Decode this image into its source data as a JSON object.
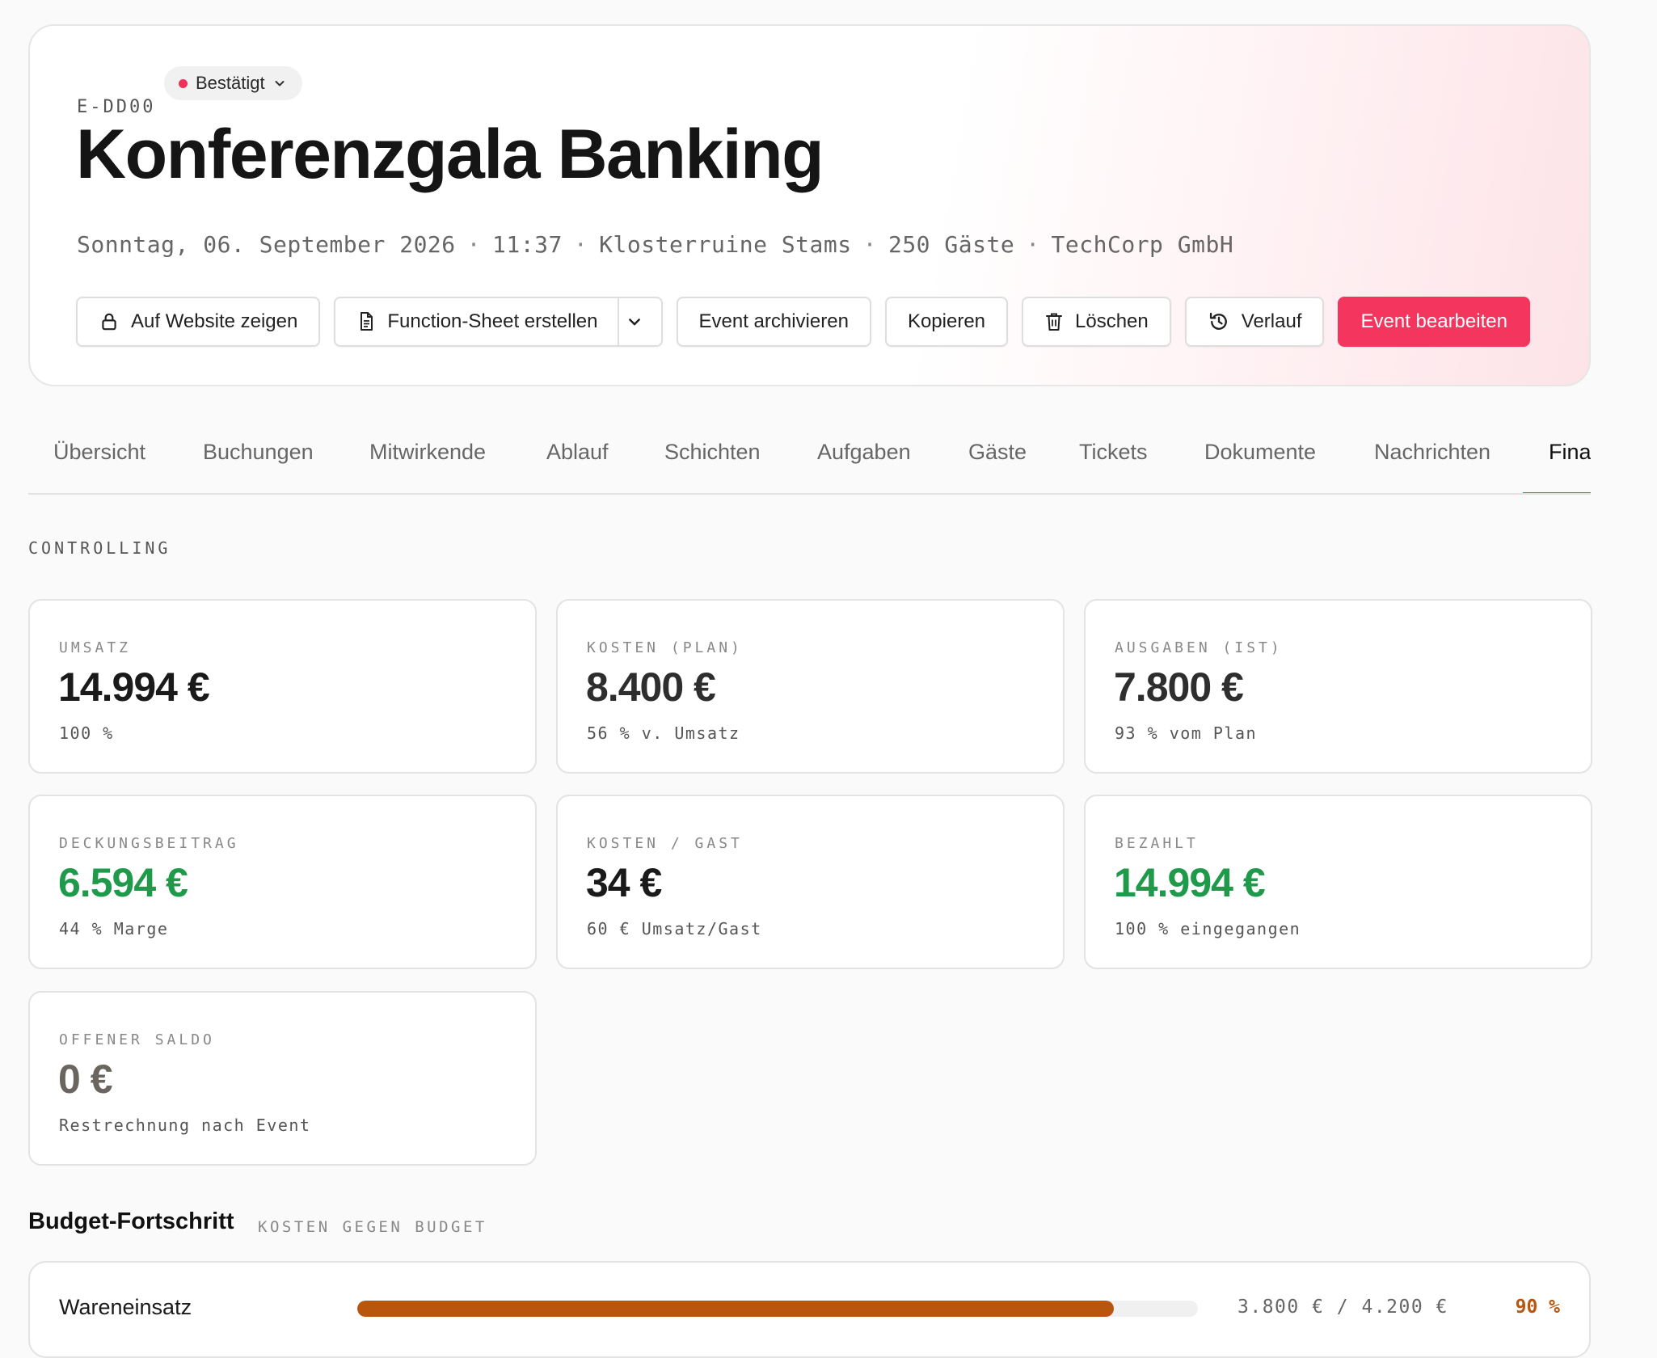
{
  "event": {
    "id": "E-DD00",
    "status": "Bestätigt",
    "title": "Konferenzgala Banking",
    "date": "Sonntag, 06. September 2026",
    "time": "11:37",
    "location": "Klosterruine Stams",
    "guests": "250 Gäste",
    "client": "TechCorp GmbH",
    "meta_separator": "·"
  },
  "actions": {
    "show_on_website": "Auf Website zeigen",
    "function_sheet": "Function-Sheet erstellen",
    "archive": "Event archivieren",
    "copy": "Kopieren",
    "delete": "Löschen",
    "history": "Verlauf",
    "edit": "Event bearbeiten"
  },
  "tabs": [
    {
      "label": "Übersicht",
      "active": false
    },
    {
      "label": "Buchungen",
      "active": false
    },
    {
      "label": "Mitwirkende",
      "active": false
    },
    {
      "label": "Ablauf",
      "active": false
    },
    {
      "label": "Schichten",
      "active": false
    },
    {
      "label": "Aufgaben",
      "active": false
    },
    {
      "label": "Gäste",
      "active": false
    },
    {
      "label": "Tickets",
      "active": false
    },
    {
      "label": "Dokumente",
      "active": false
    },
    {
      "label": "Nachrichten",
      "active": false
    },
    {
      "label": "Finanzen",
      "active": true
    }
  ],
  "controlling": {
    "section_label": "CONTROLLING",
    "kpis": [
      {
        "label": "UMSATZ",
        "value": "14.994 €",
        "sub": "100 %",
        "color": "#1a1a1a"
      },
      {
        "label": "KOSTEN (PLAN)",
        "value": "8.400 €",
        "sub": "56 % v. Umsatz",
        "color": "#2e2e2e"
      },
      {
        "label": "AUSGABEN (IST)",
        "value": "7.800 €",
        "sub": "93 % vom Plan",
        "color": "#2e2e2e"
      },
      {
        "label": "DECKUNGSBEITRAG",
        "value": "6.594 €",
        "sub": "44 % Marge",
        "color": "#1f9a4a"
      },
      {
        "label": "KOSTEN / GAST",
        "value": "34 €",
        "sub": "60 € Umsatz/Gast",
        "color": "#1a1a1a"
      },
      {
        "label": "BEZAHLT",
        "value": "14.994 €",
        "sub": "100 % eingegangen",
        "color": "#1f9a4a"
      },
      {
        "label": "OFFENER SALDO",
        "value": "0 €",
        "sub": "Restrechnung nach Event",
        "color": "#6b6560"
      }
    ]
  },
  "budget": {
    "title": "Budget-Fortschritt",
    "subtitle": "KOSTEN GEGEN BUDGET",
    "rows": [
      {
        "label": "Wareneinsatz",
        "amount": "3.800 € / 4.200 €",
        "percent_label": "90 %",
        "progress": 0.9,
        "color": "#b8560e"
      }
    ]
  },
  "colors": {
    "accent": "#f4365e",
    "status_dot": "#f0325a",
    "positive": "#1f9a4a",
    "warning": "#b8560e"
  }
}
